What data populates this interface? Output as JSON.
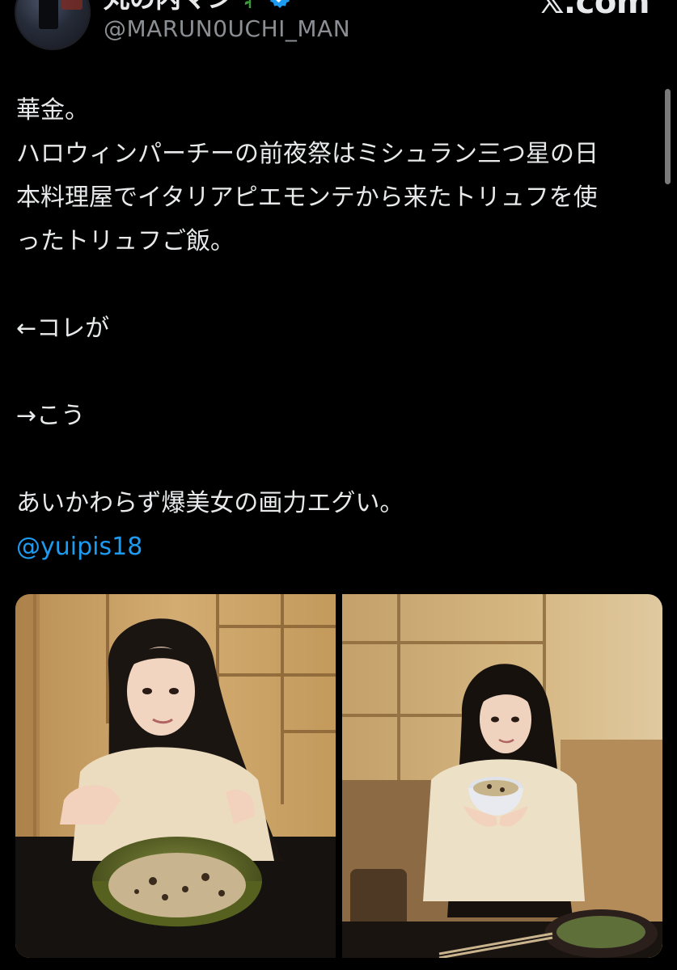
{
  "header": {
    "display_name": "丸の内マン",
    "handle": "@MARUN0UCHI_MAN",
    "site_mark": "𝕏.com",
    "avatar_icon": "profile-avatar",
    "rose_icon": "rose-icon",
    "verified_icon": "verified-badge-icon"
  },
  "post": {
    "lines": [
      "華金。",
      "ハロウィンパーチーの前夜祭はミシュラン三つ星の日",
      "本料理屋でイタリアピエモンテから来たトリュフを使",
      "ったトリュフご飯。",
      "",
      "←コレが",
      "",
      "→こう",
      "",
      "あいかわらず爆美女の画力エグい。"
    ],
    "mention": "@yuipis18"
  },
  "media": {
    "photos": [
      {
        "label": "photo-trufflerice-bowl"
      },
      {
        "label": "photo-small-bowl"
      }
    ]
  },
  "colors": {
    "background": "#000000",
    "text": "#e7e9ea",
    "secondary": "#8b8f94",
    "link": "#1d9bf0",
    "verified": "#1d9bf0"
  }
}
